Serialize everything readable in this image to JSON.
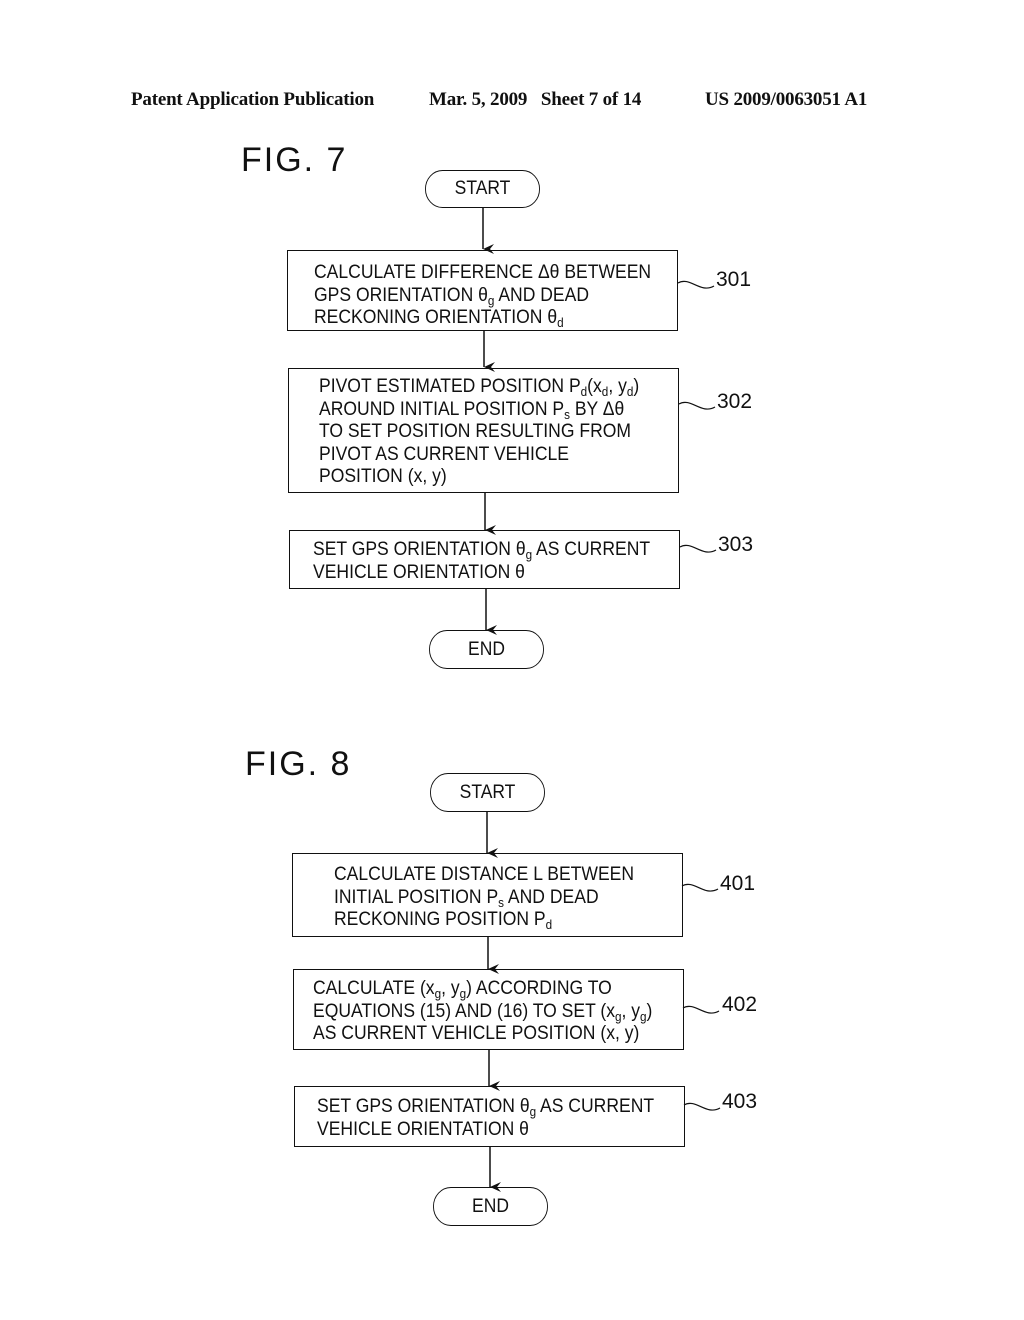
{
  "header": {
    "left": "Patent Application Publication",
    "middle": "Mar. 5, 2009   Sheet 7 of 14",
    "right": "US 2009/0063051 A1"
  },
  "fig7": {
    "title": "FIG. 7",
    "start": "START",
    "end": "END",
    "steps": [
      {
        "ref": "301",
        "lines": [
          [
            "CALCULATE DIFFERENCE Δθ BETWEEN"
          ],
          [
            "GPS ORIENTATION θ",
            {
              "sub": "g"
            },
            " AND DEAD"
          ],
          [
            "RECKONING ORIENTATION θ",
            {
              "sub": "d"
            }
          ]
        ]
      },
      {
        "ref": "302",
        "lines": [
          [
            "PIVOT ESTIMATED POSITION P",
            {
              "sub": "d"
            },
            "(x",
            {
              "sub": "d"
            },
            ", y",
            {
              "sub": "d"
            },
            ")"
          ],
          [
            "AROUND INITIAL POSITION P",
            {
              "sub": "s"
            },
            " BY Δθ"
          ],
          [
            "TO SET POSITION RESULTING FROM"
          ],
          [
            "PIVOT AS CURRENT VEHICLE"
          ],
          [
            "POSITION (x, y)"
          ]
        ]
      },
      {
        "ref": "303",
        "lines": [
          [
            "SET GPS ORIENTATION θ",
            {
              "sub": "g"
            },
            " AS CURRENT"
          ],
          [
            "VEHICLE ORIENTATION θ"
          ]
        ]
      }
    ]
  },
  "fig8": {
    "title": "FIG. 8",
    "start": "START",
    "end": "END",
    "steps": [
      {
        "ref": "401",
        "lines": [
          [
            "CALCULATE DISTANCE L BETWEEN"
          ],
          [
            "INITIAL POSITION P",
            {
              "sub": "s"
            },
            " AND DEAD"
          ],
          [
            "RECKONING POSITION P",
            {
              "sub": "d"
            }
          ]
        ]
      },
      {
        "ref": "402",
        "lines": [
          [
            "CALCULATE (x",
            {
              "sub": "g"
            },
            ", y",
            {
              "sub": "g"
            },
            ") ACCORDING TO"
          ],
          [
            "EQUATIONS (15) AND (16) TO SET (x",
            {
              "sub": "g"
            },
            ", y",
            {
              "sub": "g"
            },
            ")"
          ],
          [
            "AS CURRENT VEHICLE POSITION (x, y)"
          ]
        ]
      },
      {
        "ref": "403",
        "lines": [
          [
            "SET GPS ORIENTATION θ",
            {
              "sub": "g"
            },
            " AS CURRENT"
          ],
          [
            "VEHICLE ORIENTATION θ"
          ]
        ]
      }
    ]
  }
}
